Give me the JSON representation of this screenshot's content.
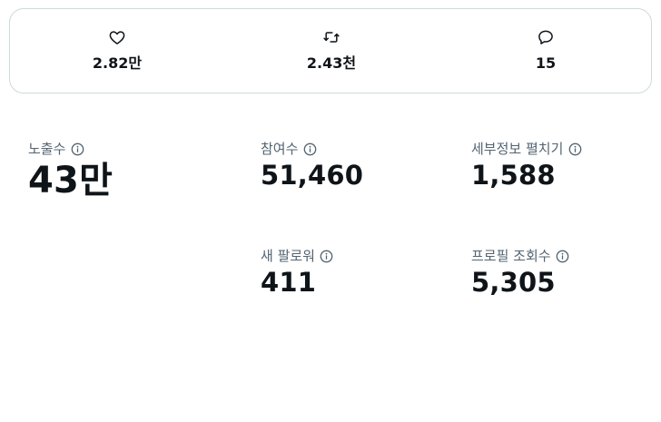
{
  "engagement": {
    "likes": {
      "icon": "heart-icon",
      "value": "2.82만"
    },
    "reposts": {
      "icon": "repost-icon",
      "value": "2.43천"
    },
    "replies": {
      "icon": "reply-icon",
      "value": "15"
    }
  },
  "metrics": {
    "impressions": {
      "label": "노출수",
      "value": "43만"
    },
    "engagements": {
      "label": "참여수",
      "value": "51,460"
    },
    "detail_expands": {
      "label": "세부정보 펼치기",
      "value": "1,588"
    },
    "new_followers": {
      "label": "새 팔로워",
      "value": "411"
    },
    "profile_visits": {
      "label": "프로필 조회수",
      "value": "5,305"
    }
  },
  "colors": {
    "text_primary": "#0f1419",
    "text_secondary": "#536471",
    "border": "#cfd9de"
  }
}
